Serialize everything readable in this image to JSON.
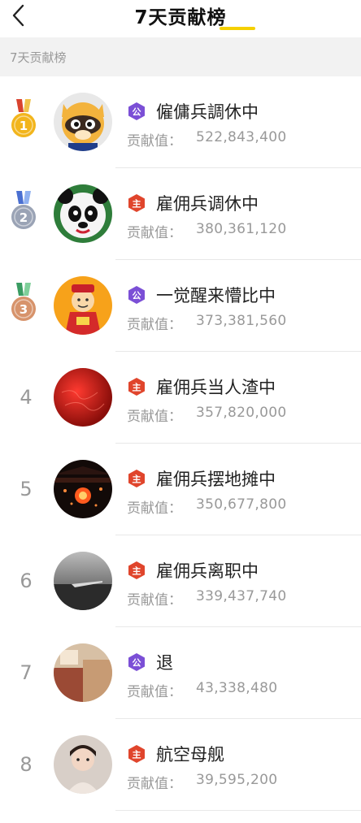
{
  "header": {
    "title": "7天贡献榜"
  },
  "section": {
    "label": "7天贡献榜"
  },
  "contrib_label": "贡献值：",
  "colors": {
    "accent": "#f5d000",
    "gold": "#f2b51c",
    "silver": "#9aa3b5",
    "bronze": "#d7936b",
    "badge_purple": "#7b4fd6",
    "badge_red": "#e0452c"
  },
  "rows": [
    {
      "rank": "1",
      "medal": "gold",
      "badge": "公",
      "badge_color": "purple",
      "name": "僱傭兵調休中",
      "value": "522,843,400",
      "avatar": "raccoon-mascot"
    },
    {
      "rank": "2",
      "medal": "silver",
      "badge": "主",
      "badge_color": "red",
      "name": "雇佣兵调休中",
      "value": "380,361,120",
      "avatar": "panda-mascot"
    },
    {
      "rank": "3",
      "medal": "bronze",
      "badge": "公",
      "badge_color": "purple",
      "name": "一觉醒来懵比中",
      "value": "373,381,560",
      "avatar": "fortune-god"
    },
    {
      "rank": "4",
      "medal": "",
      "badge": "主",
      "badge_color": "red",
      "name": "雇佣兵当人渣中",
      "value": "357,820,000",
      "avatar": "red-globe"
    },
    {
      "rank": "5",
      "medal": "",
      "badge": "主",
      "badge_color": "red",
      "name": "雇佣兵摆地摊中",
      "value": "350,677,800",
      "avatar": "lantern-night"
    },
    {
      "rank": "6",
      "medal": "",
      "badge": "主",
      "badge_color": "red",
      "name": "雇佣兵离职中",
      "value": "339,437,740",
      "avatar": "pier-landscape"
    },
    {
      "rank": "7",
      "medal": "",
      "badge": "公",
      "badge_color": "purple",
      "name": "退",
      "value": "43,338,480",
      "avatar": "room-interior"
    },
    {
      "rank": "8",
      "medal": "",
      "badge": "主",
      "badge_color": "red",
      "name": "航空母舰",
      "value": "39,595,200",
      "avatar": "child-photo"
    }
  ]
}
